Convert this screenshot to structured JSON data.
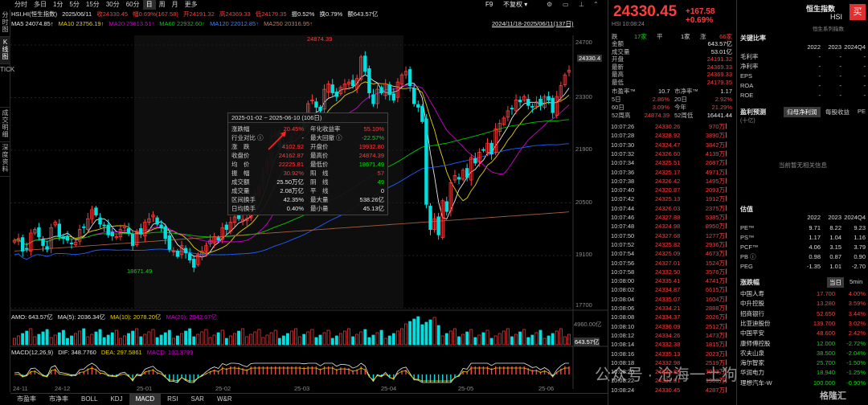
{
  "left_toolbar": {
    "tabs": [
      {
        "label": "分时图",
        "active": false
      },
      {
        "label": "K线图",
        "active": true
      },
      {
        "label": "TICK",
        "active": false
      },
      {
        "label": "成交明细",
        "active": false
      },
      {
        "label": "深度资料",
        "active": false
      }
    ]
  },
  "period_bar": {
    "items": [
      "分时",
      "多日",
      "1分",
      "5分",
      "15分",
      "30分",
      "60分",
      "日",
      "周",
      "月",
      "更多"
    ],
    "active": "日",
    "f9": "F9",
    "kline_mode": "不复权"
  },
  "ohlc_line": {
    "code": "HSI.HI(恒生指数)",
    "date": "2025/06/11",
    "close": "收24330.45",
    "change": "幅0.69%(167.58)",
    "open": "开24191.32",
    "high": "高24369.33",
    "low": "低24179.35",
    "amplitude": "振0.52%",
    "turnover": "换0.79%",
    "amount": "额643.57亿"
  },
  "ma_line": {
    "ma5": "MA5 24074.85↑",
    "ma10": "MA10 23756.19↑",
    "ma20": "MA20 23613.51↑",
    "ma60": "MA60 22932.60↑",
    "ma120": "MA120 22012.85↑",
    "ma250": "MA250 20316.95↑",
    "range": "2024/11/18-2025/06/11(137日)"
  },
  "chart_data": {
    "type": "candlestick",
    "x_tick_labels": [
      "24-11",
      "24-12",
      "25-01",
      "25-02",
      "25-03",
      "25-04",
      "25-05",
      "25-06"
    ],
    "y_tick_labels": [
      "24700",
      "23300",
      "21900",
      "20500",
      "19100",
      "17700"
    ],
    "ylim": [
      17700,
      25300
    ],
    "current_price_tag": "24330.4",
    "annotations": {
      "high": "24874.39",
      "low": "18671.49"
    },
    "closes": [
      19600,
      19650,
      19300,
      19350,
      19800,
      19900,
      19700,
      19450,
      19350,
      19950,
      20100,
      19700,
      19650,
      19600,
      19500,
      19550,
      19900,
      19950,
      20200,
      20450,
      20300,
      20050,
      20000,
      19750,
      19720,
      19700,
      19900,
      20000,
      19800,
      19450,
      19850,
      19770,
      20100,
      20200,
      20300,
      20050,
      19950,
      19650,
      19350,
      19300,
      19150,
      19450,
      19250,
      19050,
      18850,
      19200,
      19300,
      19450,
      19600,
      19700,
      19600,
      19950,
      19900,
      20100,
      20250,
      20200,
      20180,
      20200,
      20500,
      20900,
      21100,
      21500,
      21800,
      22500,
      22600,
      22200,
      22250,
      22100,
      22500,
      22800,
      22900,
      22700,
      23400,
      23500,
      23300,
      23200,
      23800,
      23950,
      23700,
      23600,
      23850,
      23950,
      24000,
      23900,
      24100,
      24700,
      24300,
      23700,
      23400,
      23800,
      23700,
      23950,
      23650,
      23500,
      24000,
      24200,
      24300,
      23900,
      23400,
      23300,
      22900,
      20600,
      19900,
      20200,
      19750,
      20700,
      20400,
      21200,
      21400,
      21300,
      21550,
      21350,
      21900,
      21750,
      22050,
      22100,
      22300,
      22000,
      22700,
      22850,
      23000,
      23200,
      23250,
      23500,
      23450,
      23600,
      23350,
      23300,
      23450,
      23350,
      23600,
      23500,
      23150,
      23600,
      23900,
      24200,
      24330
    ],
    "ma_series": [
      {
        "name": "MA5",
        "color": "#e8e8e8"
      },
      {
        "name": "MA10",
        "color": "#e8d000"
      },
      {
        "name": "MA20",
        "color": "#d000d0"
      },
      {
        "name": "MA60",
        "color": "#00c800"
      },
      {
        "name": "MA120",
        "color": "#2060ff"
      },
      {
        "name": "MA250",
        "color": "#a06040"
      }
    ]
  },
  "range_stats": {
    "header": "2025-01-02 ~ 2025-06-10 (106日)",
    "rows": [
      {
        "l1": "涨跌幅",
        "v1": "20.45%",
        "c1": "red",
        "l2": "年化收益率",
        "v2": "55.10%",
        "c2": "red"
      },
      {
        "l1": "行业对比 ⓘ",
        "v1": "-",
        "c1": "white",
        "l2": "最大回撤 ⓘ",
        "v2": "-22.57%",
        "c2": "green"
      },
      {
        "l1": "涨　跌",
        "v1": "4102.92",
        "c1": "red",
        "l2": "开盘价",
        "v2": "19932.80",
        "c2": "red"
      },
      {
        "l1": "收盘价",
        "v1": "24162.87",
        "c1": "red",
        "l2": "最高价",
        "v2": "24874.39",
        "c2": "red"
      },
      {
        "l1": "均　价",
        "v1": "22225.81",
        "c1": "red",
        "l2": "最低价",
        "v2": "18671.49",
        "c2": "green"
      },
      {
        "l1": "振　幅",
        "v1": "30.92%",
        "c1": "red",
        "l2": "阳　线",
        "v2": "57",
        "c2": "red"
      },
      {
        "l1": "成交额",
        "v1": "25.50万亿",
        "c1": "white",
        "l2": "阴　线",
        "v2": "49",
        "c2": "green"
      },
      {
        "l1": "成交量",
        "v1": "2.08万亿",
        "c1": "white",
        "l2": "平　线",
        "v2": "0",
        "c2": "white"
      },
      {
        "l1": "区间换手",
        "v1": "42.35%",
        "c1": "white",
        "l2": "最大量",
        "v2": "538.26亿",
        "c2": "white"
      },
      {
        "l1": "日均换手",
        "v1": "0.40%",
        "c1": "white",
        "l2": "最小量",
        "v2": "45.13亿",
        "c2": "white"
      }
    ]
  },
  "volume_panel": {
    "label": "AMO: 643.57亿",
    "ma5": "MA(5): 2036.34亿",
    "ma10": "MA(10): 2078.20亿",
    "ma20": "MA(20): 2042.67亿",
    "axis_top": "4960.00亿",
    "current_tag": "643.57亿"
  },
  "macd_panel": {
    "label": "MACD(12,26,9)",
    "dif": "DIF: 348.7760",
    "dea": "DEA: 297.5861",
    "macd": "MACD: 102.3799"
  },
  "indicator_tabs": [
    "市盈率",
    "市净率",
    "BOLL",
    "KDJ",
    "MACD",
    "RSI",
    "SAR",
    "W&R"
  ],
  "indicator_active": "MACD",
  "quote": {
    "price": "24330.45",
    "change": "+167.58  +0.69%",
    "name": "恒生指数",
    "code": "HSI",
    "trade_button": "买",
    "status": "HSI  10:08:24",
    "breadth": {
      "down_label": "跌",
      "down": "17家",
      "flat_label": "平",
      "flat": "1家",
      "up_label": "涨",
      "up": "66家"
    },
    "fields": [
      {
        "k": "金额",
        "v": "643.57亿",
        "c": "white"
      },
      {
        "k": "成交量",
        "v": "53.01亿",
        "c": "white"
      },
      {
        "k": "开盘",
        "v": "24191.32",
        "c": "red"
      },
      {
        "k": "最新",
        "v": "24369.33",
        "c": "red"
      },
      {
        "k": "最高",
        "v": "24369.33",
        "c": "red"
      },
      {
        "k": "最低",
        "v": "24179.35",
        "c": "red"
      }
    ],
    "pe_row": {
      "k1": "市盈率™",
      "v1": "10.7",
      "k2": "市净率™",
      "v2": "1.17"
    },
    "periods": [
      {
        "k1": "5日",
        "v1": "2.86%",
        "k2": "20日",
        "v2": "2.92%"
      },
      {
        "k1": "60日",
        "v1": "3.09%",
        "k2": "今年",
        "v2": "21.29%"
      },
      {
        "k1": "52周高",
        "v1": "24874.39",
        "k2": "52周低",
        "v2": "16441.44"
      }
    ]
  },
  "ticks": [
    {
      "t": "10:07:26",
      "p": "24330.26",
      "a": "970万",
      "c": "red"
    },
    {
      "t": "10:07:28",
      "p": "24328.92",
      "a": "3890万",
      "c": "red"
    },
    {
      "t": "10:07:30",
      "p": "24324.47",
      "a": "3842万",
      "c": "red"
    },
    {
      "t": "10:07:32",
      "p": "24326.60",
      "a": "4139万",
      "c": "red"
    },
    {
      "t": "10:07:34",
      "p": "24325.51",
      "a": "2687万",
      "c": "red"
    },
    {
      "t": "10:07:36",
      "p": "24325.17",
      "a": "4971万",
      "c": "red"
    },
    {
      "t": "10:07:38",
      "p": "24326.42",
      "a": "1495万",
      "c": "red"
    },
    {
      "t": "10:07:40",
      "p": "24320.87",
      "a": "2093万",
      "c": "red"
    },
    {
      "t": "10:07:42",
      "p": "24325.13",
      "a": "1912万",
      "c": "red"
    },
    {
      "t": "10:07:44",
      "p": "24326.03",
      "a": "2375万",
      "c": "red"
    },
    {
      "t": "10:07:46",
      "p": "24327.88",
      "a": "5385万",
      "c": "red"
    },
    {
      "t": "10:07:48",
      "p": "24324.98",
      "a": "8950万",
      "c": "red"
    },
    {
      "t": "10:07:50",
      "p": "24327.68",
      "a": "1277万",
      "c": "red"
    },
    {
      "t": "10:07:52",
      "p": "24325.82",
      "a": "2936万",
      "c": "red"
    },
    {
      "t": "10:07:54",
      "p": "24325.09",
      "a": "4673万",
      "c": "red"
    },
    {
      "t": "10:07:56",
      "p": "24327.01",
      "a": "1524万",
      "c": "red"
    },
    {
      "t": "10:07:58",
      "p": "24332.50",
      "a": "3576万",
      "c": "red"
    },
    {
      "t": "10:08:00",
      "p": "24335.41",
      "a": "4741万",
      "c": "red"
    },
    {
      "t": "10:08:02",
      "p": "24334.87",
      "a": "6615万",
      "c": "red"
    },
    {
      "t": "10:08:04",
      "p": "24335.07",
      "a": "1604万",
      "c": "red"
    },
    {
      "t": "10:08:06",
      "p": "24334.21",
      "a": "2888万",
      "c": "red"
    },
    {
      "t": "10:08:08",
      "p": "24334.37",
      "a": "2026万",
      "c": "red"
    },
    {
      "t": "10:08:10",
      "p": "24336.09",
      "a": "2512万",
      "c": "red"
    },
    {
      "t": "10:08:12",
      "p": "24334.26",
      "a": "1473万",
      "c": "red"
    },
    {
      "t": "10:08:14",
      "p": "24332.38",
      "a": "1815万",
      "c": "red"
    },
    {
      "t": "10:08:16",
      "p": "24335.13",
      "a": "2023万",
      "c": "red"
    },
    {
      "t": "10:08:18",
      "p": "24332.98",
      "a": "2519万",
      "c": "red"
    },
    {
      "t": "10:08:20",
      "p": "24331.88",
      "a": "3043万",
      "c": "red"
    },
    {
      "t": "10:08:22",
      "p": "24331.01",
      "a": "1983万",
      "c": "red"
    },
    {
      "t": "10:08:24",
      "p": "24330.45",
      "a": "4287万",
      "c": "red"
    }
  ],
  "ratios": {
    "title": "关键比率",
    "years": [
      "2022",
      "2023",
      "2024Q4"
    ],
    "rows": [
      {
        "k": "毛利率",
        "v": [
          "-",
          "-",
          "-"
        ]
      },
      {
        "k": "净利率",
        "v": [
          "-",
          "-",
          "-"
        ]
      },
      {
        "k": "EPS",
        "v": [
          "-",
          "-",
          "-"
        ]
      },
      {
        "k": "ROA",
        "v": [
          "-",
          "-",
          "-"
        ]
      },
      {
        "k": "ROE",
        "v": [
          "-",
          "-",
          "-"
        ]
      }
    ]
  },
  "forecast": {
    "title": "盈利预测",
    "subtitle": "(十亿)",
    "tabs": [
      "归母净利润",
      "每股收益",
      "PE"
    ],
    "active_tab": "归母净利润",
    "empty_text": "当前暂无相关信息"
  },
  "valuation": {
    "title": "估值",
    "years": [
      "2022",
      "2023",
      "2024Q4"
    ],
    "rows": [
      {
        "k": "PE™",
        "v": [
          "9.71",
          "8.22",
          "9.23"
        ]
      },
      {
        "k": "PS™",
        "v": [
          "1.17",
          "1.04",
          "1.16"
        ]
      },
      {
        "k": "PCF™",
        "v": [
          "4.06",
          "3.15",
          "3.79"
        ]
      },
      {
        "k": "PB ⓘ",
        "v": [
          "0.98",
          "0.87",
          "0.90"
        ]
      },
      {
        "k": "PEG",
        "v": [
          "-1.35",
          "1.01",
          "-2.70"
        ]
      }
    ]
  },
  "movers": {
    "title": "涨跌幅",
    "tabs": [
      "当日",
      "5min"
    ],
    "active_tab": "当日",
    "rows": [
      {
        "n": "中国人寿",
        "p": "17.700",
        "c": "4.00%",
        "cl": "red"
      },
      {
        "n": "中升控股",
        "p": "13.280",
        "c": "3.59%",
        "cl": "red"
      },
      {
        "n": "招商银行",
        "p": "52.650",
        "c": "3.44%",
        "cl": "red"
      },
      {
        "n": "比亚迪股份",
        "p": "139.700",
        "c": "3.02%",
        "cl": "red"
      },
      {
        "n": "中国平安",
        "p": "48.600",
        "c": "2.42%",
        "cl": "red"
      },
      {
        "n": "康师傅控股",
        "p": "12.000",
        "c": "-2.72%",
        "cl": "green"
      },
      {
        "n": "农夫山泉",
        "p": "38.500",
        "c": "-2.04%",
        "cl": "green"
      },
      {
        "n": "海尔智家",
        "p": "25.700",
        "c": "-1.50%",
        "cl": "green"
      },
      {
        "n": "华润电力",
        "p": "18.940",
        "c": "-1.25%",
        "cl": "green"
      },
      {
        "n": "理想汽车-W",
        "p": "100.000",
        "c": "-0.90%",
        "cl": "green"
      }
    ]
  },
  "watermark": {
    "text": "公众号 · 沧海一土狗",
    "logo": "格隆汇"
  },
  "colors": {
    "up": "#ff3d3d",
    "down": "#00e0e0",
    "bg": "#000000"
  }
}
